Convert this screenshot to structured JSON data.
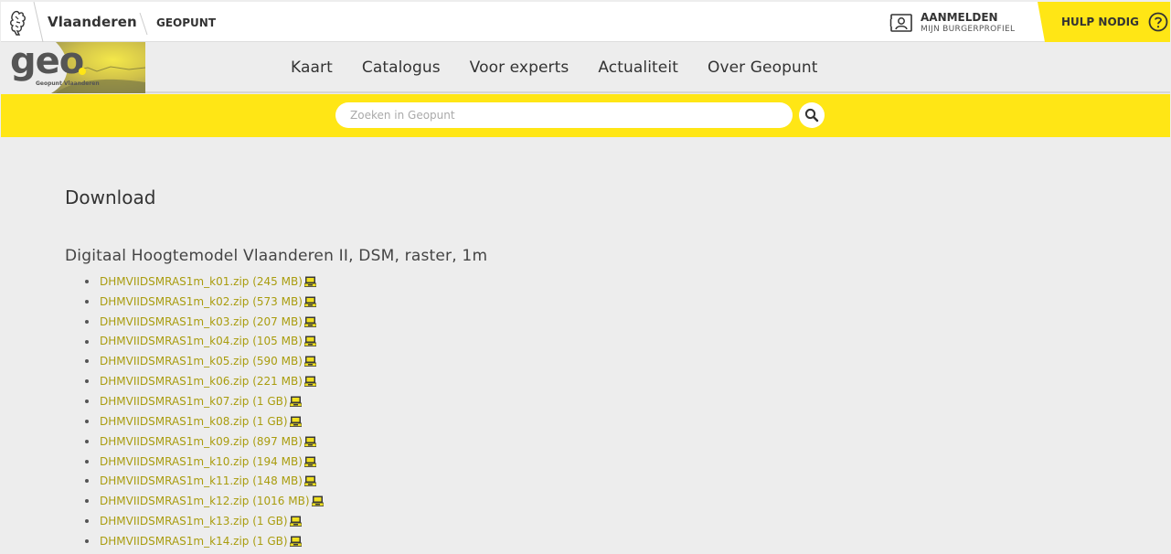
{
  "header": {
    "brand": "Vlaanderen",
    "sub_brand": "GEOPUNT",
    "login_main": "AANMELDEN",
    "login_sub": "MIJN BURGERPROFIEL",
    "help_label": "HULP NODIG"
  },
  "logo": {
    "text": "geo",
    "caption": "Geopunt Vlaanderen"
  },
  "nav": {
    "items": [
      "Kaart",
      "Catalogus",
      "Voor experts",
      "Actualiteit",
      "Over Geopunt"
    ]
  },
  "search": {
    "placeholder": "Zoeken in Geopunt"
  },
  "main": {
    "title": "Download",
    "dataset_title": "Digitaal Hoogtemodel Vlaanderen II, DSM, raster, 1m",
    "files": [
      "DHMVIIDSMRAS1m_k01.zip (245 MB)",
      "DHMVIIDSMRAS1m_k02.zip (573 MB)",
      "DHMVIIDSMRAS1m_k03.zip (207 MB)",
      "DHMVIIDSMRAS1m_k04.zip (105 MB)",
      "DHMVIIDSMRAS1m_k05.zip (590 MB)",
      "DHMVIIDSMRAS1m_k06.zip (221 MB)",
      "DHMVIIDSMRAS1m_k07.zip (1 GB)",
      "DHMVIIDSMRAS1m_k08.zip (1 GB)",
      "DHMVIIDSMRAS1m_k09.zip (897 MB)",
      "DHMVIIDSMRAS1m_k10.zip (194 MB)",
      "DHMVIIDSMRAS1m_k11.zip (148 MB)",
      "DHMVIIDSMRAS1m_k12.zip (1016 MB)",
      "DHMVIIDSMRAS1m_k13.zip (1 GB)",
      "DHMVIIDSMRAS1m_k14.zip (1 GB)"
    ]
  },
  "icons": {
    "lion": "flemish-lion-icon",
    "login": "profile-card-icon",
    "help": "question-mark-icon",
    "search": "magnifier-icon",
    "download": "download-disk-icon"
  },
  "colors": {
    "accent_yellow": "#ffe615",
    "link": "#a99c0e",
    "background": "#ededed"
  }
}
